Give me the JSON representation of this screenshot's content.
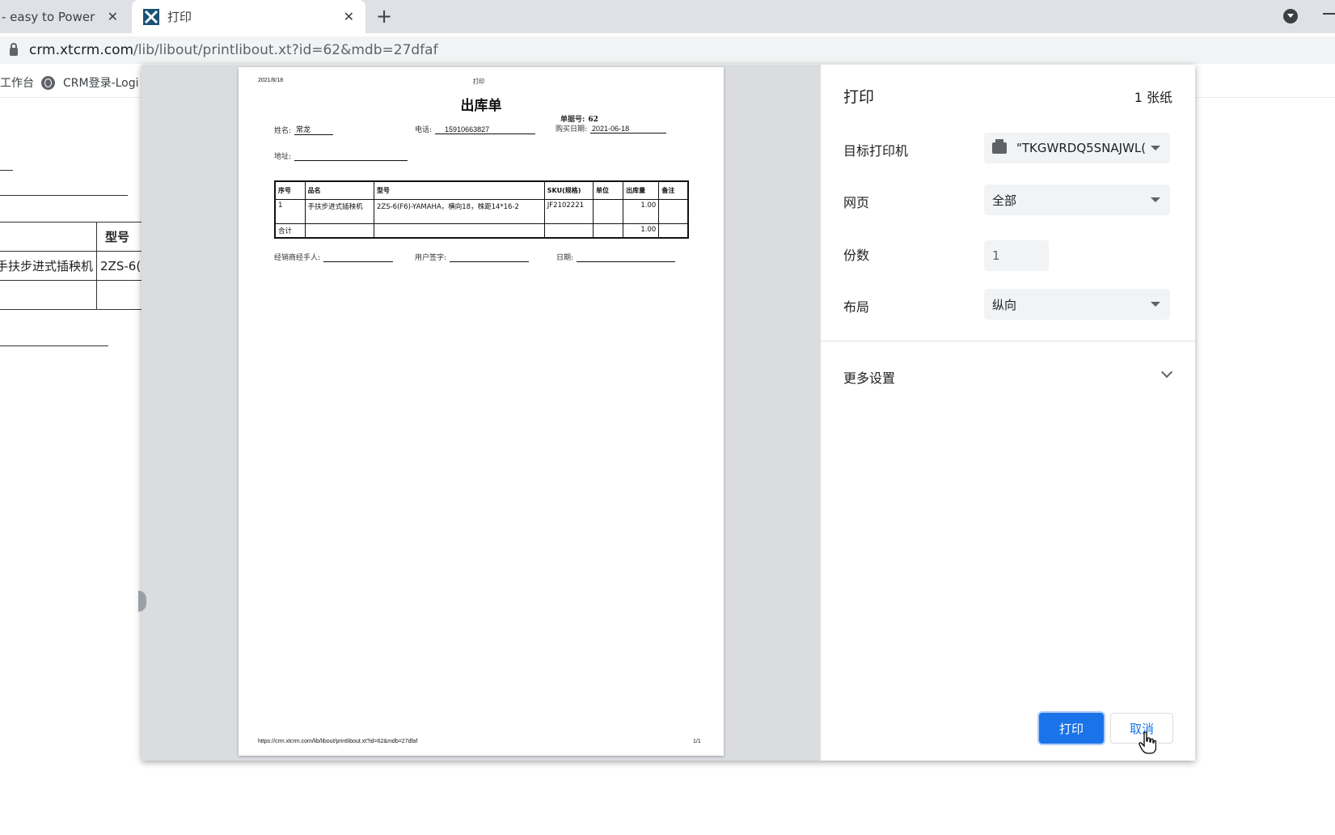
{
  "browser": {
    "tabs": [
      {
        "label": "- easy to Power",
        "active": false
      },
      {
        "label": "打印",
        "active": true
      }
    ],
    "url_host": "crm.xtcrm.com",
    "url_path": "/lib/libout/printlibout.xt?id=62&mdb=27dfaf",
    "bookmarks": [
      "工作台",
      "CRM登录-Logi"
    ]
  },
  "underlying_page": {
    "col_header": "型号",
    "row_name": "手扶步进式插秧机",
    "row_model": "2ZS-6(F6)-"
  },
  "document": {
    "header_date": "2021/6/18",
    "header_title": "打印",
    "title": "出库单",
    "order_no_label": "单据号:",
    "order_no": "62",
    "name_label": "姓名:",
    "name": "常龙",
    "phone_label": "电话:",
    "phone": "15910663827",
    "purchase_date_label": "购买日期:",
    "purchase_date": "2021-06-18",
    "address_label": "地址:",
    "address": "",
    "columns": [
      "序号",
      "品名",
      "型号",
      "SKU(规格)",
      "单位",
      "出库量",
      "备注"
    ],
    "rows": [
      {
        "no": "1",
        "product": "手扶步进式插秧机",
        "model": "2ZS-6(F6)-YAMAHA，横向18，株距14*16-2",
        "sku": "JF2102221",
        "unit": "",
        "qty": "1.00",
        "note": ""
      }
    ],
    "total_label": "合计",
    "total_qty": "1.00",
    "dealer_label": "经销商经手人:",
    "signature_label": "用户签字:",
    "date_label": "日期:",
    "footer_url": "https://crm.xtcrm.com/lib/libout/printlibout.xt?id=62&mdb=27dfaf",
    "footer_page": "1/1"
  },
  "print_settings": {
    "title": "打印",
    "sheet_count": "1 张纸",
    "destination_label": "目标打印机",
    "destination_value": "\"TKGWRDQ5SNAJWL(",
    "pages_label": "网页",
    "pages_value": "全部",
    "copies_label": "份数",
    "copies_value": "1",
    "layout_label": "布局",
    "layout_value": "纵向",
    "more_settings": "更多设置",
    "print_button": "打印",
    "cancel_button": "取消"
  },
  "colors": {
    "accent": "#1a73e8",
    "preview_bg": "#dadce0",
    "tabstrip": "#dee1e6"
  }
}
